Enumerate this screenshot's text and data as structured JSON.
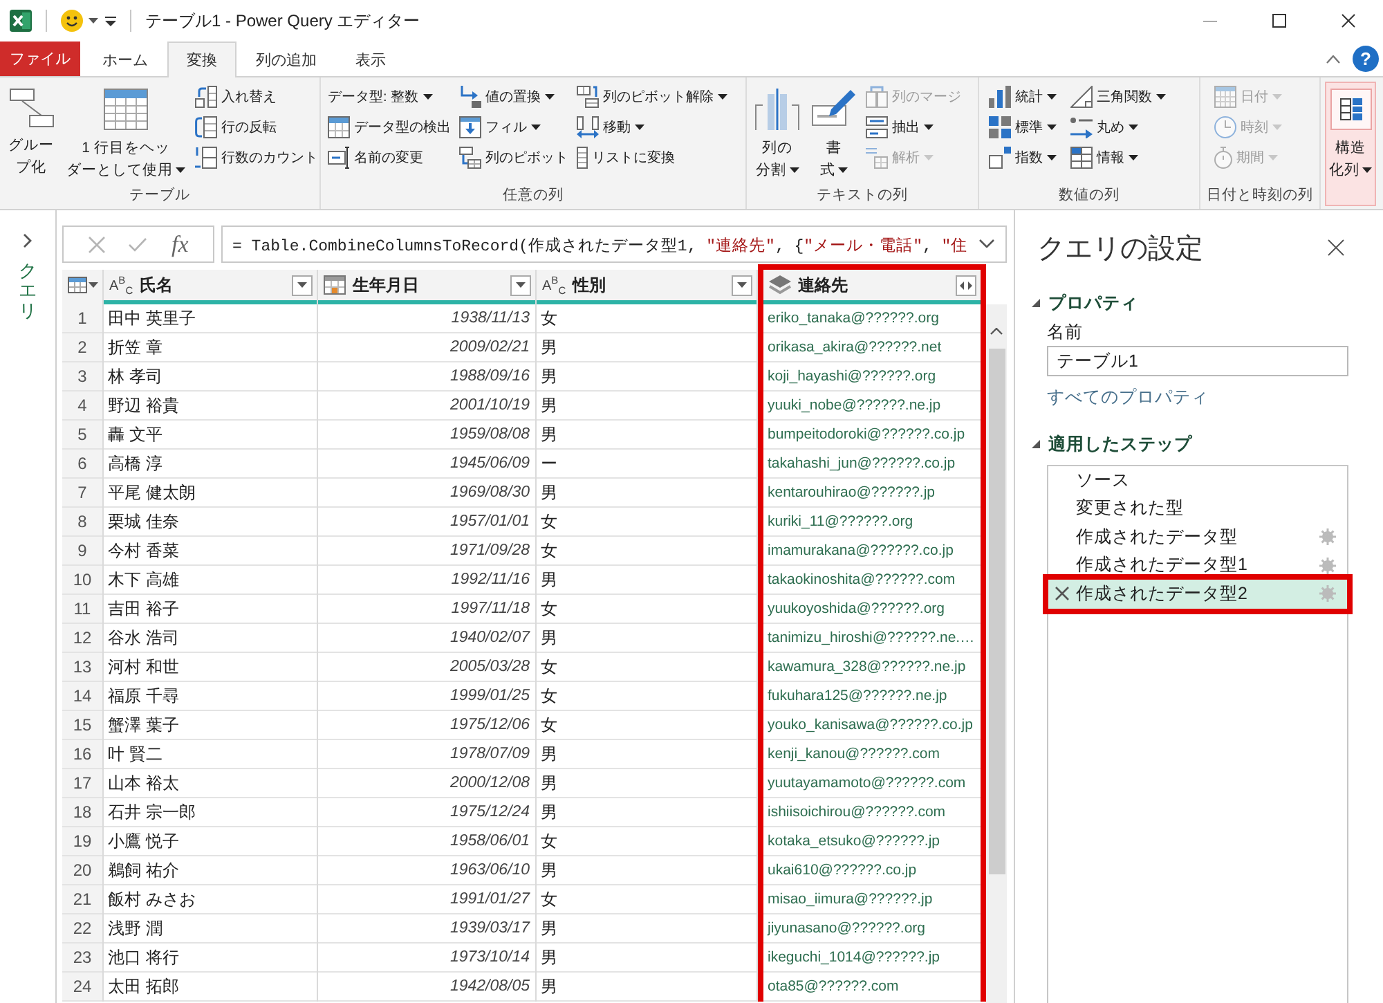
{
  "window": {
    "title": "テーブル1 - Power Query エディター"
  },
  "help_button": {
    "label": "?"
  },
  "ribbon_tabs": [
    {
      "label": "ファイル",
      "kind": "file",
      "selected": false
    },
    {
      "label": "ホーム",
      "kind": "tab",
      "selected": false
    },
    {
      "label": "変換",
      "kind": "tab",
      "selected": true
    },
    {
      "label": "列の追加",
      "kind": "tab",
      "selected": false
    },
    {
      "label": "表示",
      "kind": "tab",
      "selected": false
    }
  ],
  "ribbon_groups": [
    {
      "label": "テーブル",
      "large_buttons": [
        {
          "lines": [
            "グルー",
            "プ化"
          ],
          "menu": false,
          "hovered": false
        },
        {
          "lines": [
            "1 行目をヘッ",
            "ダーとして使用"
          ],
          "menu": true,
          "hovered": false
        }
      ],
      "columns": [
        [
          {
            "label": "入れ替え",
            "menu": false,
            "disabled": false
          },
          {
            "label": "行の反転",
            "menu": false,
            "disabled": false
          },
          {
            "label": "行数のカウント",
            "menu": false,
            "disabled": false
          }
        ]
      ]
    },
    {
      "label": "任意の列",
      "columns": [
        [
          {
            "label": "データ型: 整数",
            "menu": true,
            "disabled": false
          },
          {
            "label": "データ型の検出",
            "menu": false,
            "disabled": false
          },
          {
            "label": "名前の変更",
            "menu": false,
            "disabled": false
          }
        ],
        [
          {
            "label": "値の置換",
            "menu": true,
            "disabled": false
          },
          {
            "label": "フィル",
            "menu": true,
            "disabled": false
          },
          {
            "label": "列のピボット",
            "menu": false,
            "disabled": false
          }
        ],
        [
          {
            "label": "列のピボット解除",
            "menu": true,
            "disabled": false
          },
          {
            "label": "移動",
            "menu": true,
            "disabled": false
          },
          {
            "label": "リストに変換",
            "menu": false,
            "disabled": false
          }
        ]
      ]
    },
    {
      "label": "テキストの列",
      "large_buttons": [
        {
          "lines": [
            "列の",
            "分割"
          ],
          "menu": true,
          "hovered": false
        },
        {
          "lines": [
            "書",
            "式"
          ],
          "menu": true,
          "hovered": false
        }
      ],
      "columns": [
        [
          {
            "label": "列のマージ",
            "menu": false,
            "disabled": true
          },
          {
            "label": "抽出",
            "menu": true,
            "disabled": false
          },
          {
            "label": "解析",
            "menu": true,
            "disabled": true
          }
        ]
      ]
    },
    {
      "label": "数値の列",
      "columns": [
        [
          {
            "label": "統計",
            "menu": true,
            "disabled": false
          },
          {
            "label": "標準",
            "menu": true,
            "disabled": false
          },
          {
            "label": "指数",
            "menu": true,
            "disabled": false
          }
        ],
        [
          {
            "label": "三角関数",
            "menu": true,
            "disabled": false
          },
          {
            "label": "丸め",
            "menu": true,
            "disabled": false
          },
          {
            "label": "情報",
            "menu": true,
            "disabled": false
          }
        ]
      ]
    },
    {
      "label": "日付と時刻の列",
      "columns": [
        [
          {
            "label": "日付",
            "menu": true,
            "disabled": true
          },
          {
            "label": "時刻",
            "menu": true,
            "disabled": true
          },
          {
            "label": "期間",
            "menu": true,
            "disabled": true
          }
        ]
      ]
    },
    {
      "large_buttons": [
        {
          "lines": [
            "構造",
            "化列"
          ],
          "menu": true,
          "hovered": true
        }
      ]
    }
  ],
  "query_pane": {
    "label": "クエリ",
    "expanded": false
  },
  "formula_bar": {
    "fx": "fx",
    "tokens": [
      {
        "kind": "code",
        "text": "= Table.CombineColumnsToRecord(作成されたデータ型1, "
      },
      {
        "kind": "string",
        "text": "\"連絡先\""
      },
      {
        "kind": "code",
        "text": ", {"
      },
      {
        "kind": "string",
        "text": "\"メール・電話\""
      },
      {
        "kind": "code",
        "text": ", "
      },
      {
        "kind": "string",
        "text": "\"住"
      }
    ]
  },
  "table": {
    "columns": [
      {
        "kind": "text",
        "type_label": "A$^{B}$$_{C}$",
        "label": "氏名",
        "highlighted": false
      },
      {
        "kind": "date",
        "label": "生年月日",
        "highlighted": false
      },
      {
        "kind": "text",
        "type_label": "A$^{B}$$_{C}$",
        "label": "性別",
        "highlighted": false
      },
      {
        "kind": "record",
        "label": "連絡先",
        "highlighted": true
      }
    ],
    "rows": [
      {
        "number": "1",
        "cells": [
          "田中 英里子",
          "1938/11/13",
          "女",
          "eriko_tanaka@??????.org"
        ]
      },
      {
        "number": "2",
        "cells": [
          "折笠 章",
          "2009/02/21",
          "男",
          "orikasa_akira@??????.net"
        ]
      },
      {
        "number": "3",
        "cells": [
          "林 孝司",
          "1988/09/16",
          "男",
          "koji_hayashi@??????.org"
        ]
      },
      {
        "number": "4",
        "cells": [
          "野辺 裕貴",
          "2001/10/19",
          "男",
          "yuuki_nobe@??????.ne.jp"
        ]
      },
      {
        "number": "5",
        "cells": [
          "轟 文平",
          "1959/08/08",
          "男",
          "bumpeitodoroki@??????.co.jp"
        ]
      },
      {
        "number": "6",
        "cells": [
          "高橋 淳",
          "1945/06/09",
          "ー",
          "takahashi_jun@??????.co.jp"
        ]
      },
      {
        "number": "7",
        "cells": [
          "平尾 健太朗",
          "1969/08/30",
          "男",
          "kentarouhirao@??????.jp"
        ]
      },
      {
        "number": "8",
        "cells": [
          "栗城 佳奈",
          "1957/01/01",
          "女",
          "kuriki_11@??????.org"
        ]
      },
      {
        "number": "9",
        "cells": [
          "今村 香菜",
          "1971/09/28",
          "女",
          "imamurakana@??????.co.jp"
        ]
      },
      {
        "number": "10",
        "cells": [
          "木下 高雄",
          "1992/11/16",
          "男",
          "takaokinoshita@??????.com"
        ]
      },
      {
        "number": "11",
        "cells": [
          "吉田 裕子",
          "1997/11/18",
          "女",
          "yuukoyoshida@??????.org"
        ]
      },
      {
        "number": "12",
        "cells": [
          "谷水 浩司",
          "1940/02/07",
          "男",
          "tanimizu_hiroshi@??????.ne.…"
        ]
      },
      {
        "number": "13",
        "cells": [
          "河村 和世",
          "2005/03/28",
          "女",
          "kawamura_328@??????.ne.jp"
        ]
      },
      {
        "number": "14",
        "cells": [
          "福原 千尋",
          "1999/01/25",
          "女",
          "fukuhara125@??????.ne.jp"
        ]
      },
      {
        "number": "15",
        "cells": [
          "蟹澤 葉子",
          "1975/12/06",
          "女",
          "youko_kanisawa@??????.co.jp"
        ]
      },
      {
        "number": "16",
        "cells": [
          "叶 賢二",
          "1978/07/09",
          "男",
          "kenji_kanou@??????.com"
        ]
      },
      {
        "number": "17",
        "cells": [
          "山本 裕太",
          "2000/12/08",
          "男",
          "yuutayamamoto@??????.com"
        ]
      },
      {
        "number": "18",
        "cells": [
          "石井 宗一郎",
          "1975/12/24",
          "男",
          "ishiisoichirou@??????.com"
        ]
      },
      {
        "number": "19",
        "cells": [
          "小鷹 悦子",
          "1958/06/01",
          "女",
          "kotaka_etsuko@??????.jp"
        ]
      },
      {
        "number": "20",
        "cells": [
          "鵜飼 祐介",
          "1963/06/10",
          "男",
          "ukai610@??????.co.jp"
        ]
      },
      {
        "number": "21",
        "cells": [
          "飯村 みさお",
          "1991/01/27",
          "女",
          "misao_iimura@??????.jp"
        ]
      },
      {
        "number": "22",
        "cells": [
          "浅野 潤",
          "1939/03/17",
          "男",
          "jiyunasano@??????.org"
        ]
      },
      {
        "number": "23",
        "cells": [
          "池口 将行",
          "1973/10/14",
          "男",
          "ikeguchi_1014@??????.jp"
        ]
      },
      {
        "number": "24",
        "cells": [
          "太田 拓郎",
          "1942/08/05",
          "男",
          "ota85@??????.com"
        ]
      }
    ]
  },
  "query_settings": {
    "title": "クエリの設定",
    "properties": {
      "heading": "プロパティ",
      "expanded": true,
      "name_label": "名前",
      "name_value": "テーブル1",
      "all_properties_link": "すべてのプロパティ"
    },
    "applied_steps": {
      "heading": "適用したステップ",
      "expanded": true,
      "steps": [
        {
          "label": "ソース",
          "selected": false,
          "settings": false,
          "highlighted": false
        },
        {
          "label": "変更された型",
          "selected": false,
          "settings": false,
          "highlighted": false
        },
        {
          "label": "作成されたデータ型",
          "selected": false,
          "settings": true,
          "highlighted": false
        },
        {
          "label": "作成されたデータ型1",
          "selected": false,
          "settings": true,
          "highlighted": false
        },
        {
          "label": "作成されたデータ型2",
          "selected": true,
          "settings": true,
          "highlighted": true
        }
      ]
    }
  }
}
